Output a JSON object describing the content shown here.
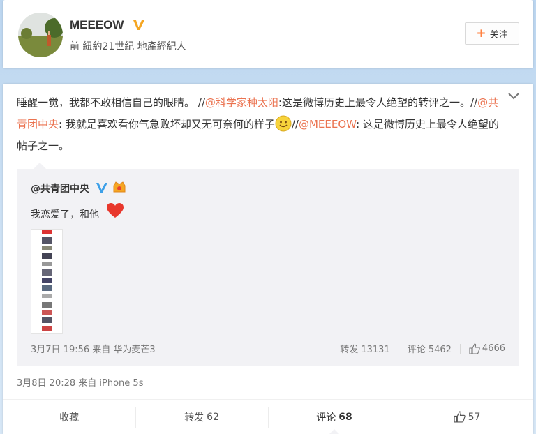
{
  "profile": {
    "name": "MEEEOW",
    "description": "前 紐約21世紀 地產經紀人",
    "follow_label": "关注",
    "verified_color": "#f5a623"
  },
  "post": {
    "text_part1": "睡醒一觉，我都不敢相信自己的眼睛。 //",
    "mention1": "@科学家种太阳",
    "text_part2": ":这是微博历史上最令人绝望的转评之一。//",
    "mention2": "@共青团中央",
    "text_part3": ": 我就是喜欢看你气急败坏却又无可奈何的样子",
    "text_part4": "//",
    "mention3": "@MEEEOW",
    "text_part5": ": 这是微博历史上最令人绝望的帖子之一。",
    "meta": "3月8日 20:28 来自 iPhone 5s",
    "mention_color": "#eb7350"
  },
  "quote": {
    "author": "@共青团中央",
    "text": "我恋爱了，和他",
    "meta": "3月7日 19:56 来自 华为麦芒3",
    "repost_label": "转发 13131",
    "comment_label": "评论 5462",
    "like_count": "4666"
  },
  "toolbar": {
    "favorite_label": "收藏",
    "repost_label": "转发",
    "repost_count": "62",
    "comment_label": "评论",
    "comment_count": "68",
    "like_count": "57"
  },
  "icons": {
    "verified": "verified-v-icon",
    "menu": "chevron-down-icon",
    "like": "thumbs-up-icon",
    "smiley": "smiley-icon",
    "heart": "heart-icon"
  }
}
